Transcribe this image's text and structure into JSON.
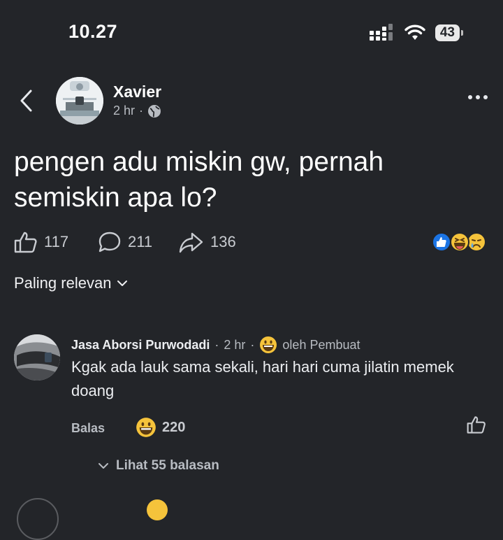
{
  "status_bar": {
    "time": "10.27",
    "battery": "43"
  },
  "post": {
    "author": "Xavier",
    "time": "2 hr",
    "separator": "·",
    "text": "pengen adu miskin gw, pernah semiskin apa lo?",
    "likes": "117",
    "comments": "211",
    "shares": "136"
  },
  "sort": {
    "label": "Paling relevan"
  },
  "comment": {
    "author": "Jasa Aborsi Purwodadi",
    "time": "2 hr",
    "sep1": "·",
    "sep2": "·",
    "creator_label": "oleh Pembuat",
    "text": "Kgak ada lauk sama sekali, hari hari cuma jilatin memek doang",
    "reply_label": "Balas",
    "reaction_count": "220",
    "view_replies": "Lihat 55 balasan"
  },
  "colors": {
    "background": "#232529",
    "like_blue": "#1b74e4",
    "emoji_yellow": "#f5c33b"
  }
}
